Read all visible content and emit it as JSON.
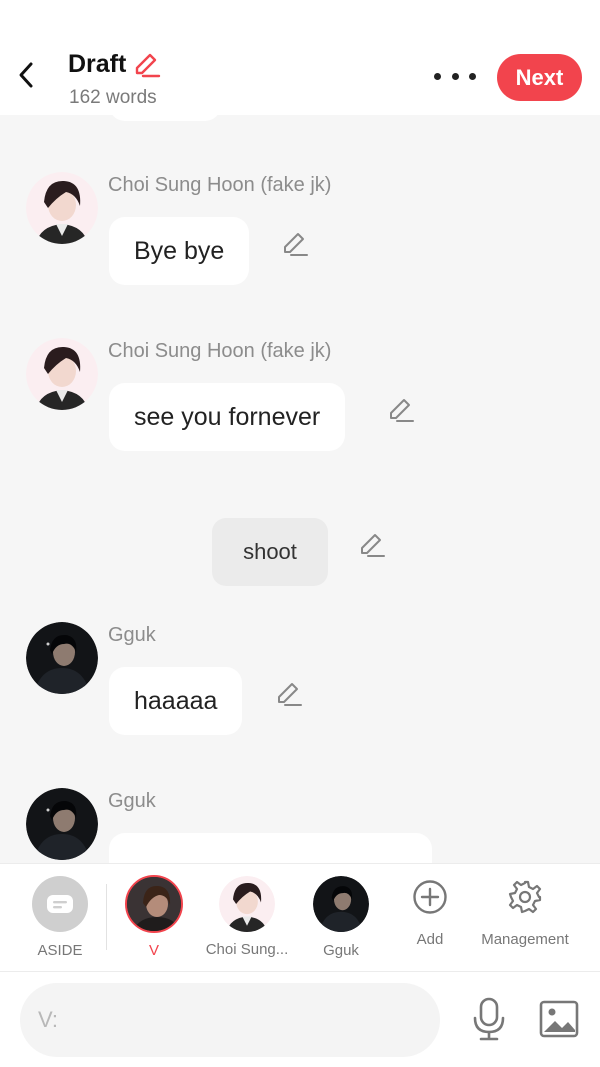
{
  "header": {
    "title": "Draft",
    "word_count": "162 words",
    "next_label": "Next"
  },
  "messages": [
    {
      "sender": "Choi Sung Hoon (fake jk)",
      "text": "Bye bye"
    },
    {
      "sender": "Choi Sung Hoon (fake jk)",
      "text": "see you fornever"
    },
    {
      "aside": "shoot"
    },
    {
      "sender": "Gguk",
      "text": "haaaaa"
    },
    {
      "sender": "Gguk",
      "text": ""
    }
  ],
  "characters": [
    {
      "label": "ASIDE",
      "icon": "aside-icon"
    },
    {
      "label": "V",
      "selected": true
    },
    {
      "label": "Choi Sung..."
    },
    {
      "label": "Gguk"
    },
    {
      "label": "Add",
      "icon": "plus-circle-icon"
    },
    {
      "label": "Management",
      "icon": "gear-icon"
    }
  ],
  "input": {
    "placeholder": "V:"
  },
  "colors": {
    "accent": "#f2444d",
    "background": "#f6f6f6",
    "bubble": "#ffffff",
    "aside_bubble": "#ebebeb",
    "muted_text": "#8c8c8c"
  }
}
